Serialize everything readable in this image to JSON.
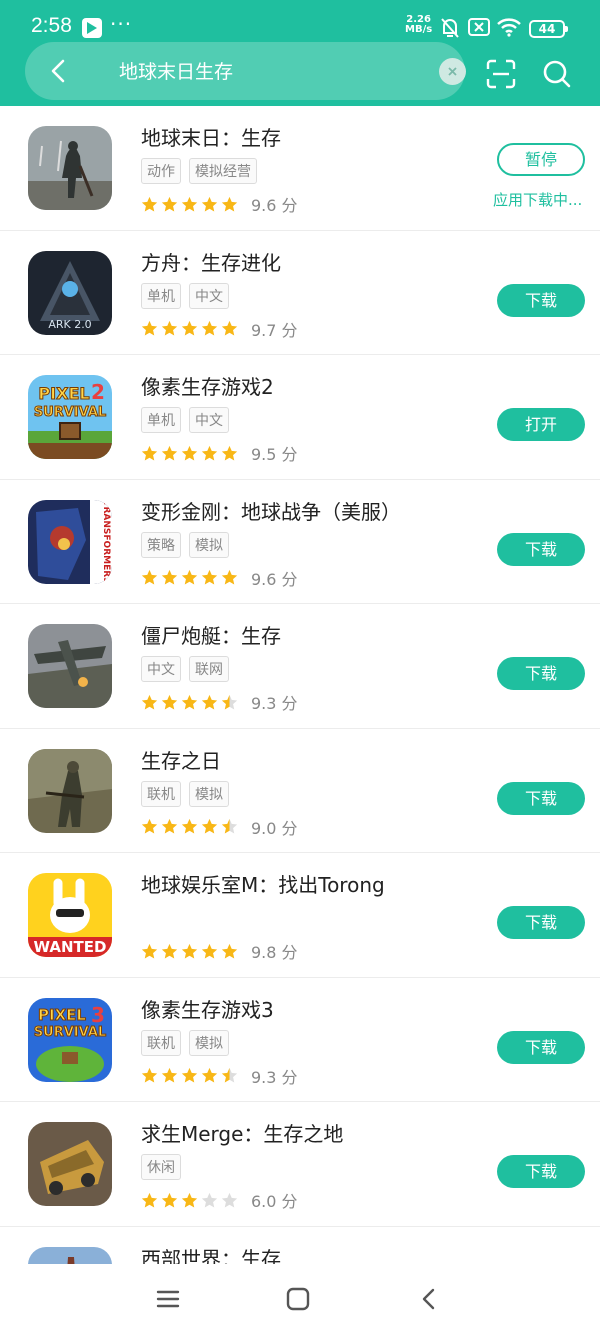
{
  "status_bar": {
    "time": "2:58",
    "more": "···",
    "net_speed_value": "2.26",
    "net_speed_unit": "MB/s",
    "battery": "44"
  },
  "search": {
    "query": "地球末日生存"
  },
  "colors": {
    "accent": "#1fbf9f",
    "star": "#f8b716",
    "star_empty": "#dddddd"
  },
  "apps": [
    {
      "name": "地球末日：生存",
      "tags": [
        "动作",
        "模拟经营"
      ],
      "rating": 5,
      "score": "9.6 分",
      "button": "暂停",
      "button_style": "outline",
      "status": "应用下载中...",
      "icon": "last-day-on-earth-icon"
    },
    {
      "name": "方舟：生存进化",
      "tags": [
        "单机",
        "中文"
      ],
      "rating": 5,
      "score": "9.7 分",
      "button": "下载",
      "icon": "ark-icon"
    },
    {
      "name": "像素生存游戏2",
      "tags": [
        "单机",
        "中文"
      ],
      "rating": 5,
      "score": "9.5 分",
      "button": "打开",
      "icon": "pixel-survival-2-icon"
    },
    {
      "name": "变形金刚：地球战争（美服）",
      "tags": [
        "策略",
        "模拟"
      ],
      "rating": 5,
      "score": "9.6 分",
      "button": "下载",
      "icon": "transformers-icon"
    },
    {
      "name": "僵尸炮艇：生存",
      "tags": [
        "中文",
        "联网"
      ],
      "rating": 4.5,
      "score": "9.3 分",
      "button": "下载",
      "icon": "zombie-gunship-icon"
    },
    {
      "name": "生存之日",
      "tags": [
        "联机",
        "模拟"
      ],
      "rating": 4.5,
      "score": "9.0 分",
      "button": "下载",
      "icon": "day-r-icon"
    },
    {
      "name": "地球娱乐室M：找出Torong",
      "tags": [],
      "rating": 5,
      "score": "9.8 分",
      "button": "下载",
      "icon": "wanted-icon"
    },
    {
      "name": "像素生存游戏3",
      "tags": [
        "联机",
        "模拟"
      ],
      "rating": 4.5,
      "score": "9.3 分",
      "button": "下载",
      "icon": "pixel-survival-3-icon"
    },
    {
      "name": "求生Merge：生存之地",
      "tags": [
        "休闲"
      ],
      "rating": 3,
      "score": "6.0 分",
      "button": "下载",
      "icon": "survival-merge-icon"
    },
    {
      "name": "西部世界：生存",
      "tags": [],
      "rating": 0,
      "score": "",
      "button": "",
      "icon": "westland-icon"
    }
  ],
  "icon_text": {
    "ark": "ARK 2.0",
    "pixel2": [
      "PIXEL",
      "SURVIVAL",
      "2"
    ],
    "transformers": "TRANSFORMERS",
    "pixel3": [
      "PIXEL",
      "SURVIVAL",
      "3"
    ],
    "wanted": "WANTED"
  }
}
